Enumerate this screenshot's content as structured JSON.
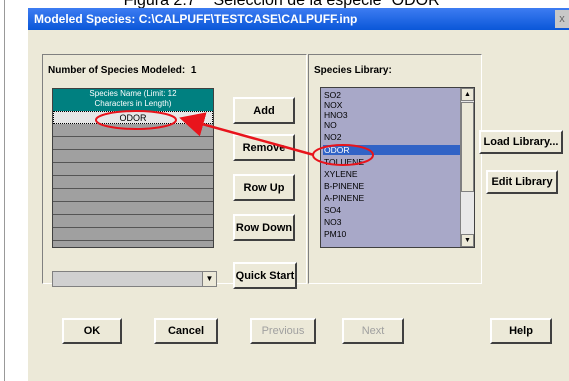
{
  "caption": "Figura 2.7    Selección de la especie \"ODOR\"",
  "window": {
    "title": "Modeled Species: C:\\CALPUFF\\TESTCASE\\CALPUFF.inp",
    "close_label": "x"
  },
  "modeled": {
    "count_label": "Number of Species Modeled:",
    "count_value": "1",
    "grid_header_line1": "Species Name (Limit: 12",
    "grid_header_line2": "Characters in Length)",
    "rows": [
      "ODOR",
      "",
      "",
      "",
      "",
      "",
      "",
      "",
      "",
      ""
    ],
    "combo_value": ""
  },
  "buttons": {
    "add": "Add",
    "remove": "Remove",
    "row_up": "Row Up",
    "row_down": "Row Down",
    "quick_start": "Quick Start",
    "load_library": "Load Library...",
    "edit_library": "Edit Library",
    "ok": "OK",
    "cancel": "Cancel",
    "previous": "Previous",
    "next": "Next",
    "help": "Help"
  },
  "library": {
    "label": "Species Library:",
    "items": [
      "SO2",
      "NOX",
      "HNO3",
      "NO",
      "NO2",
      "ODOR",
      "TOLUENE",
      "XYLENE",
      "B-PINENE",
      "A-PINENE",
      "SO4",
      "NO3",
      "PM10"
    ],
    "selected": "ODOR"
  },
  "colors": {
    "annotation": "#e8141c",
    "selection": "#3163c6",
    "grid_header": "#008080"
  }
}
